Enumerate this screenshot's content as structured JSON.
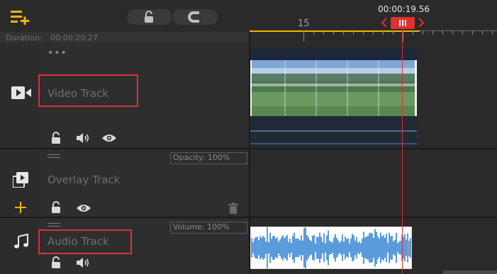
{
  "toolbar": {
    "add_track_icon": "add-track-icon",
    "lock_icon": "unlock-icon",
    "magnet_icon": "magnet-icon"
  },
  "timeline": {
    "current_time": "00:00:19.56",
    "ruler_mark": "15",
    "duration_label": "Duration:",
    "duration_value": "00:00:20.27"
  },
  "tracks": {
    "video": {
      "label": "Video Track"
    },
    "overlay": {
      "label": "Overlay Track",
      "opacity": "Opacity: 100%"
    },
    "audio": {
      "label": "Audio Track",
      "volume": "Volume: 100%"
    }
  },
  "colors": {
    "accent": "#f5b40a",
    "playhead": "#e03030",
    "highlight": "#d8323a",
    "waveform": "#5a9bdc"
  }
}
